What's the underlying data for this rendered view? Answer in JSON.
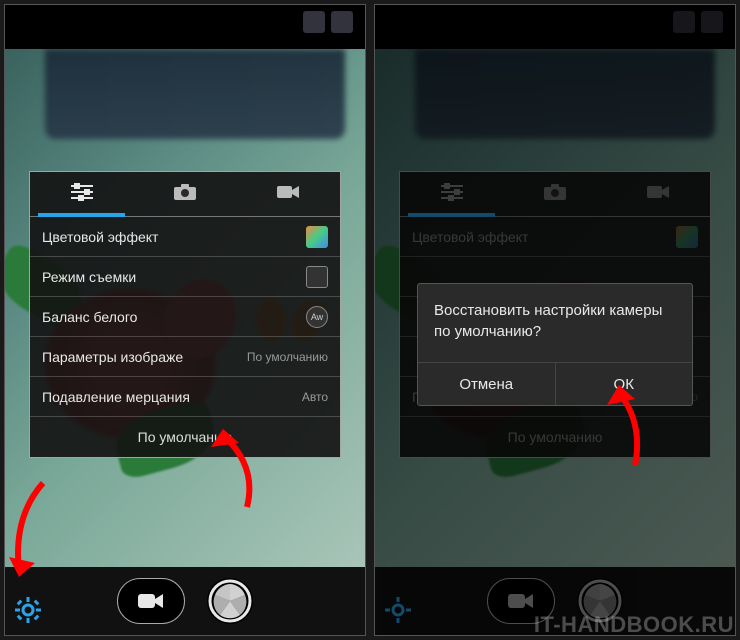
{
  "left": {
    "settings_rows": {
      "color_effect": "Цветовой эффект",
      "scene_mode": "Режим съемки",
      "white_balance": "Баланс белого",
      "image_params": "Параметры изображе",
      "image_params_value": "По умолчанию",
      "flicker": "Подавление мерцания",
      "flicker_value": "Авто",
      "restore_defaults": "По умолчанию"
    }
  },
  "right": {
    "settings_rows": {
      "color_effect": "Цветовой эффект",
      "flicker": "Подавление мерцания",
      "flicker_value": "Авто",
      "restore_defaults": "По умолчанию"
    },
    "dialog": {
      "message": "Восстановить настройки камеры по умолчанию?",
      "cancel": "Отмена",
      "ok": "ОК"
    }
  },
  "watermark": "IT-HANDBOOK.RU",
  "wb_badge": "Aw"
}
